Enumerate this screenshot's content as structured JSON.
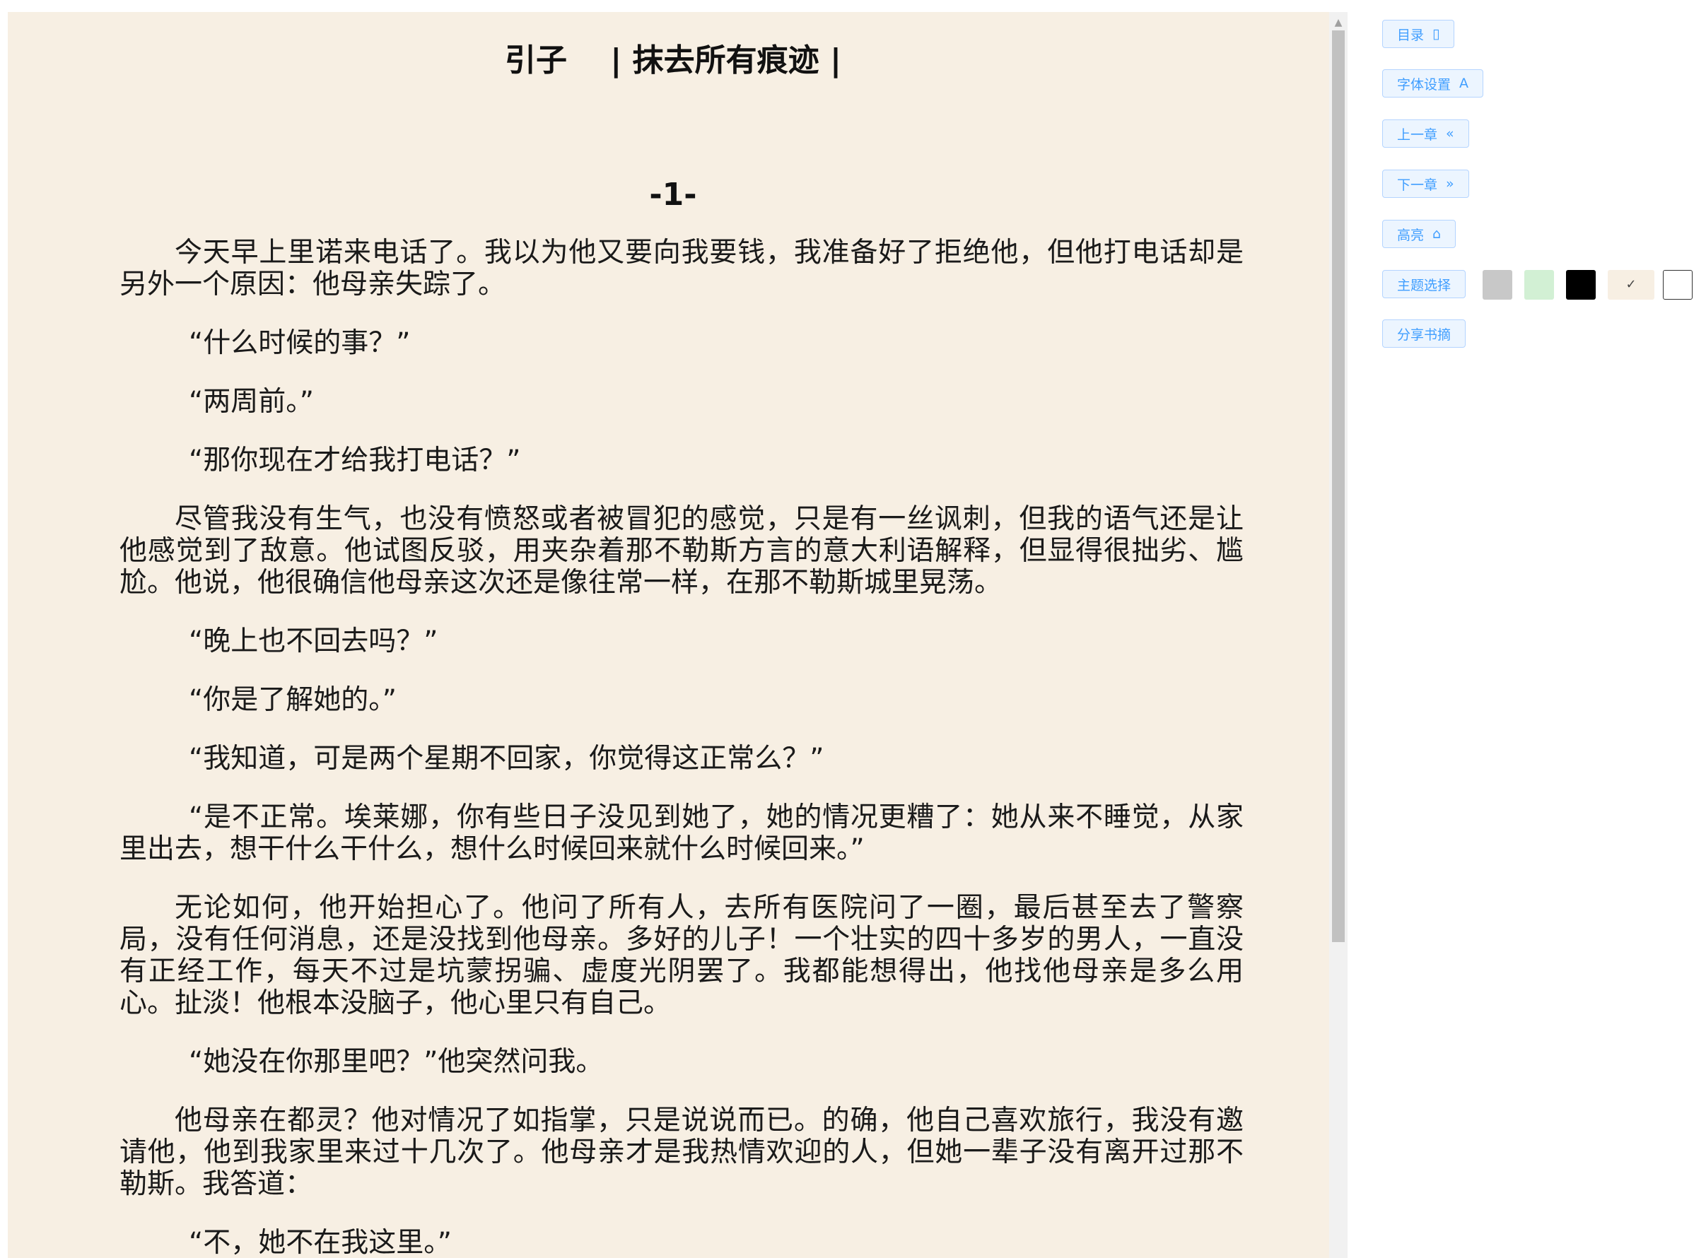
{
  "chapter": {
    "title": "引子    | 抹去所有痕迹 |",
    "section": "-1-"
  },
  "paragraphs": [
    {
      "text": "今天早上里诺来电话了。我以为他又要向我要钱，我准备好了拒绝他，但他打电话却是另外一个原因：他母亲失踪了。",
      "quote": false
    },
    {
      "text": "“什么时候的事？”",
      "quote": true
    },
    {
      "text": "“两周前。”",
      "quote": true
    },
    {
      "text": "“那你现在才给我打电话？”",
      "quote": true
    },
    {
      "text": "尽管我没有生气，也没有愤怒或者被冒犯的感觉，只是有一丝讽刺，但我的语气还是让他感觉到了敌意。他试图反驳，用夹杂着那不勒斯方言的意大利语解释，但显得很拙劣、尴尬。他说，他很确信他母亲这次还是像往常一样，在那不勒斯城里晃荡。",
      "quote": false
    },
    {
      "text": "“晚上也不回去吗？”",
      "quote": true
    },
    {
      "text": "“你是了解她的。”",
      "quote": true
    },
    {
      "text": "“我知道，可是两个星期不回家，你觉得这正常么？”",
      "quote": true
    },
    {
      "text": "“是不正常。埃莱娜，你有些日子没见到她了，她的情况更糟了：她从来不睡觉，从家里出去，想干什么干什么，想什么时候回来就什么时候回来。”",
      "quote": true
    },
    {
      "text": "无论如何，他开始担心了。他问了所有人，去所有医院问了一圈，最后甚至去了警察局，没有任何消息，还是没找到他母亲。多好的儿子！一个壮实的四十多岁的男人，一直没有正经工作，每天不过是坑蒙拐骗、虚度光阴罢了。我都能想得出，他找他母亲是多么用心。扯淡！他根本没脑子，他心里只有自己。",
      "quote": false
    },
    {
      "text": "“她没在你那里吧？”他突然问我。",
      "quote": true
    },
    {
      "text": "他母亲在都灵？他对情况了如指掌，只是说说而已。的确，他自己喜欢旅行，我没有邀请他，他到我家里来过十几次了。他母亲才是我热情欢迎的人，但她一辈子没有离开过那不勒斯。我答道：",
      "quote": false
    },
    {
      "text": "“不，她不在我这里。”",
      "quote": true
    }
  ],
  "toolbar": {
    "toc": {
      "label": "目录",
      "icon": "document-icon",
      "glyph": "▯"
    },
    "font": {
      "label": "字体设置",
      "icon": "font-icon",
      "glyph": "A"
    },
    "prev": {
      "label": "上一章",
      "icon": "double-chevron-left-icon",
      "glyph": "«"
    },
    "next": {
      "label": "下一章",
      "icon": "double-chevron-right-icon",
      "glyph": "»"
    },
    "highlight": {
      "label": "高亮",
      "icon": "lock-icon",
      "glyph": "⌂"
    },
    "theme": {
      "label": "主题选择"
    },
    "share": {
      "label": "分享书摘"
    }
  },
  "themes": [
    {
      "name": "gray",
      "color": "#c8c8c8",
      "selected": false
    },
    {
      "name": "green",
      "color": "#d2f0d4",
      "selected": false
    },
    {
      "name": "black",
      "color": "#000000",
      "selected": false
    },
    {
      "name": "beige",
      "color": "#f7efe3",
      "selected": true,
      "check": "✓"
    },
    {
      "name": "white",
      "color": "#ffffff",
      "selected": false
    }
  ],
  "colors": {
    "accent": "#409eff",
    "accent_bg": "#ecf5ff",
    "accent_border": "#b4d4ff",
    "reader_bg": "#f7efe3"
  }
}
